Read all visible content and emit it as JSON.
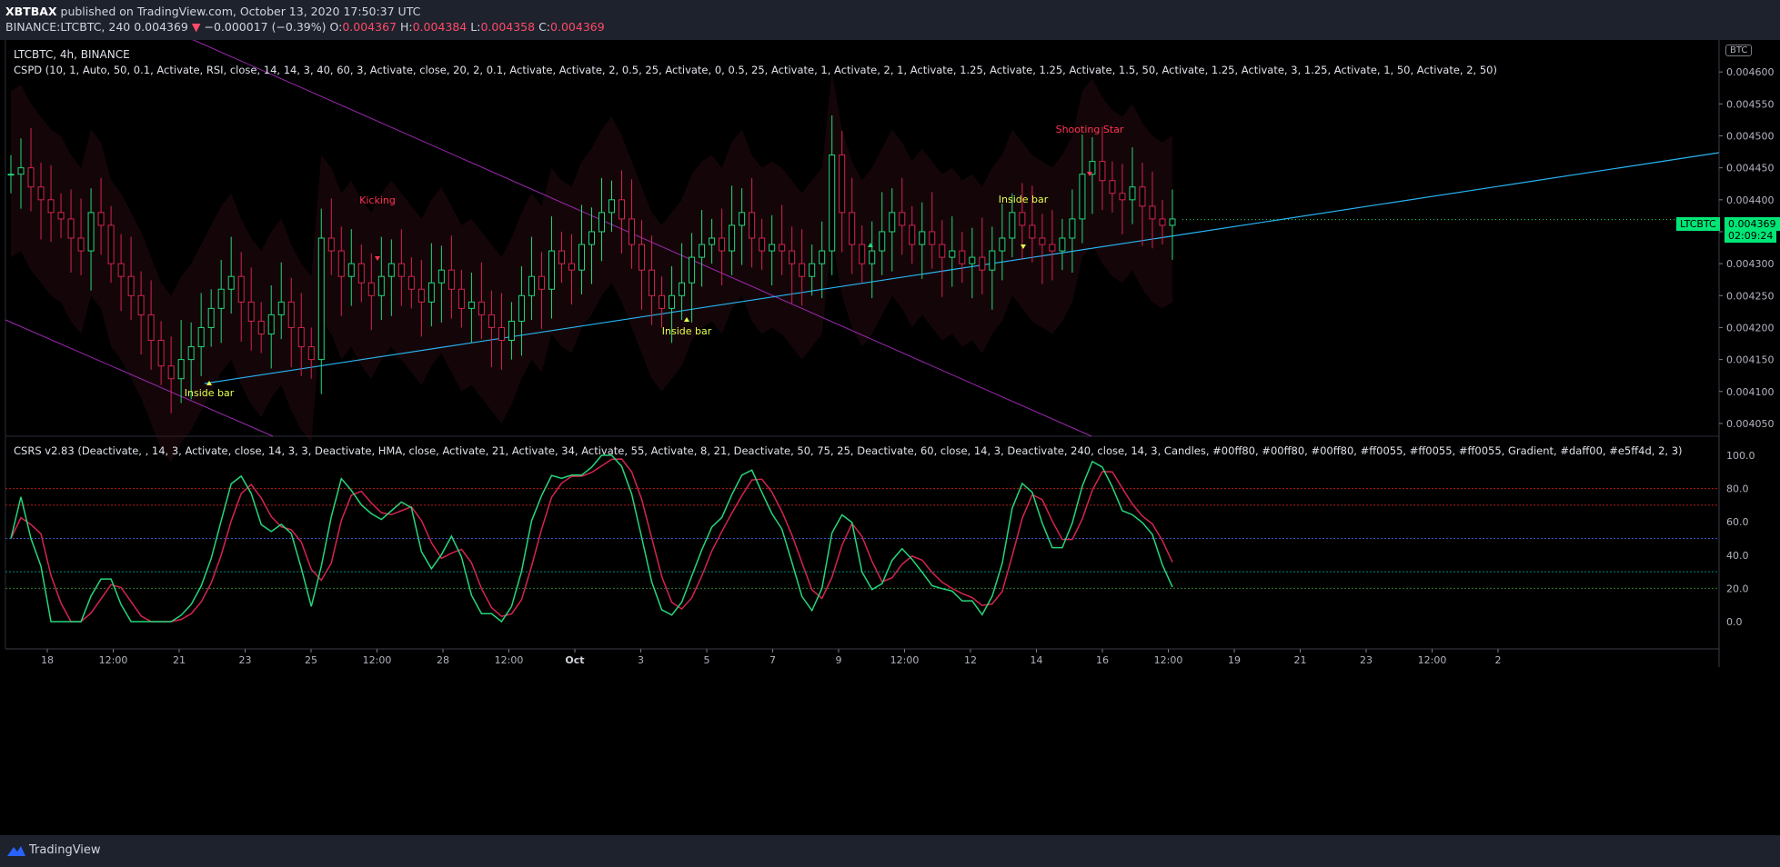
{
  "header": {
    "author": "XBTBAX",
    "published_text": " published on TradingView.com, October 13, 2020 17:50:37 UTC",
    "symbol_line": "BINANCE:LTCBTC, 240",
    "last_price": "0.004369",
    "change": "−0.000017 (−0.39%)",
    "o_label": "O:",
    "o_value": "0.004367",
    "h_label": "H:",
    "h_value": "0.004384",
    "l_label": "L:",
    "l_value": "0.004358",
    "c_label": "C:",
    "c_value": "0.004369"
  },
  "main_pane": {
    "title": "LTCBTC, 4h, BINANCE",
    "indicator": "CSPD (10, 1, Auto, 50, 0.1, Activate, RSI, close, 14, 14, 3, 40, 60, 3, Activate, close, 20, 2, 0.1, Activate, Activate, 2, 0.5, 25, Activate, 0, 0.5, 25, Activate, 1, Activate, 2, 1, Activate, 1.25, Activate, 1.25, Activate, 1.5, 50, Activate, 1.25, Activate, 3, 1.25, Activate, 1, 50, Activate, 2, 50)",
    "currency_badge": "BTC",
    "symbol_badge": "LTCBTC",
    "price_badge": "0.004369",
    "time_badge": "02:09:24",
    "y_ticks": [
      "0.004600",
      "0.004550",
      "0.004500",
      "0.004450",
      "0.004400",
      "0.004350",
      "0.004300",
      "0.004250",
      "0.004200",
      "0.004150",
      "0.004100",
      "0.004050"
    ],
    "annotations": [
      {
        "text": "Kicking",
        "color": "#ff3355"
      },
      {
        "text": "Shooting Star",
        "color": "#ff3355"
      },
      {
        "text": "Inside bar",
        "color": "#e5ff4d"
      },
      {
        "text": "Inside bar",
        "color": "#e5ff4d"
      },
      {
        "text": "Inside bar",
        "color": "#e5ff4d"
      }
    ]
  },
  "lower_pane": {
    "indicator": "CSRS v2.83 (Deactivate, , 14, 3, Activate, close, 14, 3, 3, Deactivate, HMA, close, Activate, 21, Activate, 34, Activate, 55, Activate, 8, 21, Deactivate, 50, 75, 25, Deactivate, 60, close, 14, 3, Deactivate, 240, close, 14, 3, Candles, #00ff80, #00ff80, #00ff80, #ff0055, #ff0055, #ff0055, Gradient, #daff00, #e5ff4d, 2, 3)",
    "y_ticks": [
      "100.0",
      "80.0",
      "60.0",
      "40.0",
      "20.0",
      "0.0"
    ]
  },
  "x_axis": {
    "ticks": [
      "18",
      "12:00",
      "21",
      "23",
      "25",
      "12:00",
      "28",
      "12:00",
      "Oct",
      "3",
      "5",
      "7",
      "9",
      "12:00",
      "12",
      "14",
      "16",
      "12:00",
      "19",
      "21",
      "23",
      "12:00",
      "2"
    ]
  },
  "footer": {
    "brand": "TradingView"
  },
  "colors": {
    "up": "#26d67a",
    "down": "#d4244f",
    "trendline": "#29b6f6",
    "channel": "#9c27b0"
  },
  "chart_data": {
    "type": "candlestick",
    "symbol": "LTCBTC",
    "ylim": [
      0.00403,
      0.00465
    ],
    "close_series": [
      0.00444,
      0.00445,
      0.00442,
      0.0044,
      0.00438,
      0.00437,
      0.00434,
      0.00432,
      0.00438,
      0.00436,
      0.0043,
      0.00428,
      0.00425,
      0.00422,
      0.00418,
      0.00414,
      0.00412,
      0.00415,
      0.00417,
      0.0042,
      0.00423,
      0.00426,
      0.00428,
      0.00424,
      0.00421,
      0.00419,
      0.00422,
      0.00424,
      0.0042,
      0.00417,
      0.00415,
      0.00434,
      0.00432,
      0.00428,
      0.0043,
      0.00427,
      0.00425,
      0.00428,
      0.0043,
      0.00428,
      0.00426,
      0.00424,
      0.00427,
      0.00429,
      0.00426,
      0.00423,
      0.00424,
      0.00422,
      0.0042,
      0.00418,
      0.00421,
      0.00425,
      0.00428,
      0.00426,
      0.00432,
      0.0043,
      0.00429,
      0.00433,
      0.00435,
      0.00438,
      0.0044,
      0.00437,
      0.00433,
      0.00429,
      0.00425,
      0.00423,
      0.00425,
      0.00427,
      0.00431,
      0.00433,
      0.00434,
      0.00432,
      0.00436,
      0.00438,
      0.00434,
      0.00432,
      0.00433,
      0.00432,
      0.0043,
      0.00428,
      0.0043,
      0.00432,
      0.00447,
      0.00438,
      0.00433,
      0.0043,
      0.00432,
      0.00435,
      0.00438,
      0.00436,
      0.00433,
      0.00435,
      0.00433,
      0.00431,
      0.00432,
      0.0043,
      0.00431,
      0.00429,
      0.00432,
      0.00434,
      0.00438,
      0.00436,
      0.00434,
      0.00433,
      0.00432,
      0.00434,
      0.00437,
      0.00444,
      0.00446,
      0.00443,
      0.00441,
      0.0044,
      0.00442,
      0.00439,
      0.00437,
      0.00436,
      0.00437
    ]
  },
  "osc_data": {
    "type": "line",
    "ylim": [
      0,
      100
    ],
    "levels": [
      80,
      70,
      50,
      30,
      20
    ]
  }
}
